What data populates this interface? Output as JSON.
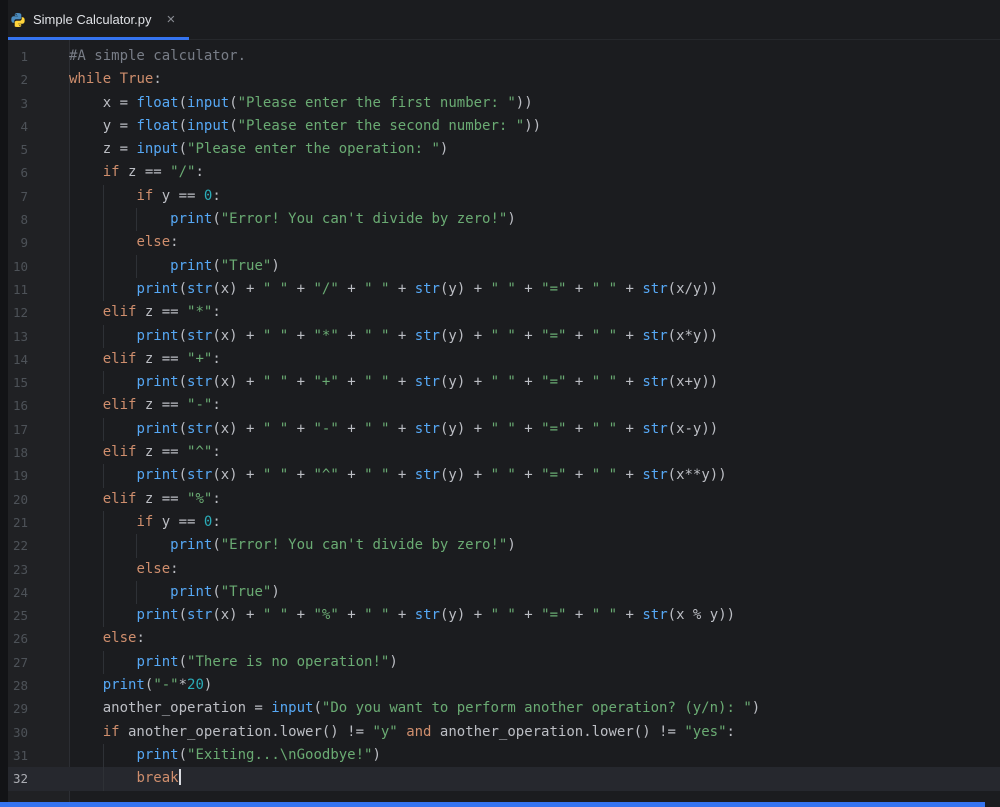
{
  "tab_bar": {
    "tabs": [
      {
        "title": "Simple Calculator.py",
        "active": true
      }
    ]
  },
  "icons": {
    "close": "×",
    "file_type": "python-logo-icon"
  },
  "colors": {
    "accent": "#3574f0",
    "keyword": "#cf8e6d",
    "string": "#6aab73",
    "number": "#2aacb8",
    "builtin": "#56a8f5",
    "comment": "#787d87",
    "text": "#bcbec4",
    "line_number": "#4d5258",
    "caret_row": "#26282e"
  },
  "editor": {
    "caret_line": 32,
    "lines": [
      {
        "n": 1,
        "i": 0,
        "t": [
          [
            "c",
            "#A simple calculator."
          ]
        ]
      },
      {
        "n": 2,
        "i": 0,
        "t": [
          [
            "k",
            "while"
          ],
          [
            "p",
            " "
          ],
          [
            "k",
            "True"
          ],
          [
            "p",
            ":"
          ]
        ]
      },
      {
        "n": 3,
        "i": 1,
        "t": [
          [
            "p",
            "x = "
          ],
          [
            "f",
            "float"
          ],
          [
            "p",
            "("
          ],
          [
            "f",
            "input"
          ],
          [
            "p",
            "("
          ],
          [
            "s",
            "\"Please enter the first number: \""
          ],
          [
            "p",
            "))"
          ]
        ]
      },
      {
        "n": 4,
        "i": 1,
        "t": [
          [
            "p",
            "y = "
          ],
          [
            "f",
            "float"
          ],
          [
            "p",
            "("
          ],
          [
            "f",
            "input"
          ],
          [
            "p",
            "("
          ],
          [
            "s",
            "\"Please enter the second number: \""
          ],
          [
            "p",
            "))"
          ]
        ]
      },
      {
        "n": 5,
        "i": 1,
        "t": [
          [
            "p",
            "z = "
          ],
          [
            "f",
            "input"
          ],
          [
            "p",
            "("
          ],
          [
            "s",
            "\"Please enter the operation: \""
          ],
          [
            "p",
            ")"
          ]
        ]
      },
      {
        "n": 6,
        "i": 1,
        "t": [
          [
            "k",
            "if"
          ],
          [
            "p",
            " z == "
          ],
          [
            "s",
            "\"/\""
          ],
          [
            "p",
            ":"
          ]
        ]
      },
      {
        "n": 7,
        "i": 2,
        "t": [
          [
            "k",
            "if"
          ],
          [
            "p",
            " y == "
          ],
          [
            "n",
            "0"
          ],
          [
            "p",
            ":"
          ]
        ]
      },
      {
        "n": 8,
        "i": 3,
        "t": [
          [
            "f",
            "print"
          ],
          [
            "p",
            "("
          ],
          [
            "s",
            "\"Error! You can't divide by zero!\""
          ],
          [
            "p",
            ")"
          ]
        ]
      },
      {
        "n": 9,
        "i": 2,
        "t": [
          [
            "k",
            "else"
          ],
          [
            "p",
            ":"
          ]
        ]
      },
      {
        "n": 10,
        "i": 3,
        "t": [
          [
            "f",
            "print"
          ],
          [
            "p",
            "("
          ],
          [
            "s",
            "\"True\""
          ],
          [
            "p",
            ")"
          ]
        ]
      },
      {
        "n": 11,
        "i": 2,
        "t": [
          [
            "f",
            "print"
          ],
          [
            "p",
            "("
          ],
          [
            "f",
            "str"
          ],
          [
            "p",
            "(x) + "
          ],
          [
            "s",
            "\" \""
          ],
          [
            "p",
            " + "
          ],
          [
            "s",
            "\"/\""
          ],
          [
            "p",
            " + "
          ],
          [
            "s",
            "\" \""
          ],
          [
            "p",
            " + "
          ],
          [
            "f",
            "str"
          ],
          [
            "p",
            "(y) + "
          ],
          [
            "s",
            "\" \""
          ],
          [
            "p",
            " + "
          ],
          [
            "s",
            "\"=\""
          ],
          [
            "p",
            " + "
          ],
          [
            "s",
            "\" \""
          ],
          [
            "p",
            " + "
          ],
          [
            "f",
            "str"
          ],
          [
            "p",
            "(x/y))"
          ]
        ]
      },
      {
        "n": 12,
        "i": 1,
        "t": [
          [
            "k",
            "elif"
          ],
          [
            "p",
            " z == "
          ],
          [
            "s",
            "\"*\""
          ],
          [
            "p",
            ":"
          ]
        ]
      },
      {
        "n": 13,
        "i": 2,
        "t": [
          [
            "f",
            "print"
          ],
          [
            "p",
            "("
          ],
          [
            "f",
            "str"
          ],
          [
            "p",
            "(x) + "
          ],
          [
            "s",
            "\" \""
          ],
          [
            "p",
            " + "
          ],
          [
            "s",
            "\"*\""
          ],
          [
            "p",
            " + "
          ],
          [
            "s",
            "\" \""
          ],
          [
            "p",
            " + "
          ],
          [
            "f",
            "str"
          ],
          [
            "p",
            "(y) + "
          ],
          [
            "s",
            "\" \""
          ],
          [
            "p",
            " + "
          ],
          [
            "s",
            "\"=\""
          ],
          [
            "p",
            " + "
          ],
          [
            "s",
            "\" \""
          ],
          [
            "p",
            " + "
          ],
          [
            "f",
            "str"
          ],
          [
            "p",
            "(x*y))"
          ]
        ]
      },
      {
        "n": 14,
        "i": 1,
        "t": [
          [
            "k",
            "elif"
          ],
          [
            "p",
            " z == "
          ],
          [
            "s",
            "\"+\""
          ],
          [
            "p",
            ":"
          ]
        ]
      },
      {
        "n": 15,
        "i": 2,
        "t": [
          [
            "f",
            "print"
          ],
          [
            "p",
            "("
          ],
          [
            "f",
            "str"
          ],
          [
            "p",
            "(x) + "
          ],
          [
            "s",
            "\" \""
          ],
          [
            "p",
            " + "
          ],
          [
            "s",
            "\"+\""
          ],
          [
            "p",
            " + "
          ],
          [
            "s",
            "\" \""
          ],
          [
            "p",
            " + "
          ],
          [
            "f",
            "str"
          ],
          [
            "p",
            "(y) + "
          ],
          [
            "s",
            "\" \""
          ],
          [
            "p",
            " + "
          ],
          [
            "s",
            "\"=\""
          ],
          [
            "p",
            " + "
          ],
          [
            "s",
            "\" \""
          ],
          [
            "p",
            " + "
          ],
          [
            "f",
            "str"
          ],
          [
            "p",
            "(x+y))"
          ]
        ]
      },
      {
        "n": 16,
        "i": 1,
        "t": [
          [
            "k",
            "elif"
          ],
          [
            "p",
            " z == "
          ],
          [
            "s",
            "\"-\""
          ],
          [
            "p",
            ":"
          ]
        ]
      },
      {
        "n": 17,
        "i": 2,
        "t": [
          [
            "f",
            "print"
          ],
          [
            "p",
            "("
          ],
          [
            "f",
            "str"
          ],
          [
            "p",
            "(x) + "
          ],
          [
            "s",
            "\" \""
          ],
          [
            "p",
            " + "
          ],
          [
            "s",
            "\"-\""
          ],
          [
            "p",
            " + "
          ],
          [
            "s",
            "\" \""
          ],
          [
            "p",
            " + "
          ],
          [
            "f",
            "str"
          ],
          [
            "p",
            "(y) + "
          ],
          [
            "s",
            "\" \""
          ],
          [
            "p",
            " + "
          ],
          [
            "s",
            "\"=\""
          ],
          [
            "p",
            " + "
          ],
          [
            "s",
            "\" \""
          ],
          [
            "p",
            " + "
          ],
          [
            "f",
            "str"
          ],
          [
            "p",
            "(x-y))"
          ]
        ]
      },
      {
        "n": 18,
        "i": 1,
        "t": [
          [
            "k",
            "elif"
          ],
          [
            "p",
            " z == "
          ],
          [
            "s",
            "\"^\""
          ],
          [
            "p",
            ":"
          ]
        ]
      },
      {
        "n": 19,
        "i": 2,
        "t": [
          [
            "f",
            "print"
          ],
          [
            "p",
            "("
          ],
          [
            "f",
            "str"
          ],
          [
            "p",
            "(x) + "
          ],
          [
            "s",
            "\" \""
          ],
          [
            "p",
            " + "
          ],
          [
            "s",
            "\"^\""
          ],
          [
            "p",
            " + "
          ],
          [
            "s",
            "\" \""
          ],
          [
            "p",
            " + "
          ],
          [
            "f",
            "str"
          ],
          [
            "p",
            "(y) + "
          ],
          [
            "s",
            "\" \""
          ],
          [
            "p",
            " + "
          ],
          [
            "s",
            "\"=\""
          ],
          [
            "p",
            " + "
          ],
          [
            "s",
            "\" \""
          ],
          [
            "p",
            " + "
          ],
          [
            "f",
            "str"
          ],
          [
            "p",
            "(x**y))"
          ]
        ]
      },
      {
        "n": 20,
        "i": 1,
        "t": [
          [
            "k",
            "elif"
          ],
          [
            "p",
            " z == "
          ],
          [
            "s",
            "\"%\""
          ],
          [
            "p",
            ":"
          ]
        ]
      },
      {
        "n": 21,
        "i": 2,
        "t": [
          [
            "k",
            "if"
          ],
          [
            "p",
            " y == "
          ],
          [
            "n",
            "0"
          ],
          [
            "p",
            ":"
          ]
        ]
      },
      {
        "n": 22,
        "i": 3,
        "t": [
          [
            "f",
            "print"
          ],
          [
            "p",
            "("
          ],
          [
            "s",
            "\"Error! You can't divide by zero!\""
          ],
          [
            "p",
            ")"
          ]
        ]
      },
      {
        "n": 23,
        "i": 2,
        "t": [
          [
            "k",
            "else"
          ],
          [
            "p",
            ":"
          ]
        ]
      },
      {
        "n": 24,
        "i": 3,
        "t": [
          [
            "f",
            "print"
          ],
          [
            "p",
            "("
          ],
          [
            "s",
            "\"True\""
          ],
          [
            "p",
            ")"
          ]
        ]
      },
      {
        "n": 25,
        "i": 2,
        "t": [
          [
            "f",
            "print"
          ],
          [
            "p",
            "("
          ],
          [
            "f",
            "str"
          ],
          [
            "p",
            "(x) + "
          ],
          [
            "s",
            "\" \""
          ],
          [
            "p",
            " + "
          ],
          [
            "s",
            "\"%\""
          ],
          [
            "p",
            " + "
          ],
          [
            "s",
            "\" \""
          ],
          [
            "p",
            " + "
          ],
          [
            "f",
            "str"
          ],
          [
            "p",
            "(y) + "
          ],
          [
            "s",
            "\" \""
          ],
          [
            "p",
            " + "
          ],
          [
            "s",
            "\"=\""
          ],
          [
            "p",
            " + "
          ],
          [
            "s",
            "\" \""
          ],
          [
            "p",
            " + "
          ],
          [
            "f",
            "str"
          ],
          [
            "p",
            "(x % y))"
          ]
        ]
      },
      {
        "n": 26,
        "i": 1,
        "t": [
          [
            "k",
            "else"
          ],
          [
            "p",
            ":"
          ]
        ]
      },
      {
        "n": 27,
        "i": 2,
        "t": [
          [
            "f",
            "print"
          ],
          [
            "p",
            "("
          ],
          [
            "s",
            "\"There is no operation!\""
          ],
          [
            "p",
            ")"
          ]
        ]
      },
      {
        "n": 28,
        "i": 1,
        "t": [
          [
            "f",
            "print"
          ],
          [
            "p",
            "("
          ],
          [
            "s",
            "\"-\""
          ],
          [
            "p",
            "*"
          ],
          [
            "n",
            "20"
          ],
          [
            "p",
            ")"
          ]
        ]
      },
      {
        "n": 29,
        "i": 1,
        "t": [
          [
            "p",
            "another_operation = "
          ],
          [
            "f",
            "input"
          ],
          [
            "p",
            "("
          ],
          [
            "s",
            "\"Do you want to perform another operation? (y/n): \""
          ],
          [
            "p",
            ")"
          ]
        ]
      },
      {
        "n": 30,
        "i": 1,
        "t": [
          [
            "k",
            "if"
          ],
          [
            "p",
            " another_operation.lower() != "
          ],
          [
            "s",
            "\"y\""
          ],
          [
            "p",
            " "
          ],
          [
            "k",
            "and"
          ],
          [
            "p",
            " another_operation.lower() != "
          ],
          [
            "s",
            "\"yes\""
          ],
          [
            "p",
            ":"
          ]
        ]
      },
      {
        "n": 31,
        "i": 2,
        "t": [
          [
            "f",
            "print"
          ],
          [
            "p",
            "("
          ],
          [
            "s",
            "\"Exiting...\\nGoodbye!\""
          ],
          [
            "p",
            ")"
          ]
        ]
      },
      {
        "n": 32,
        "i": 2,
        "t": [
          [
            "k",
            "break"
          ]
        ]
      }
    ]
  }
}
